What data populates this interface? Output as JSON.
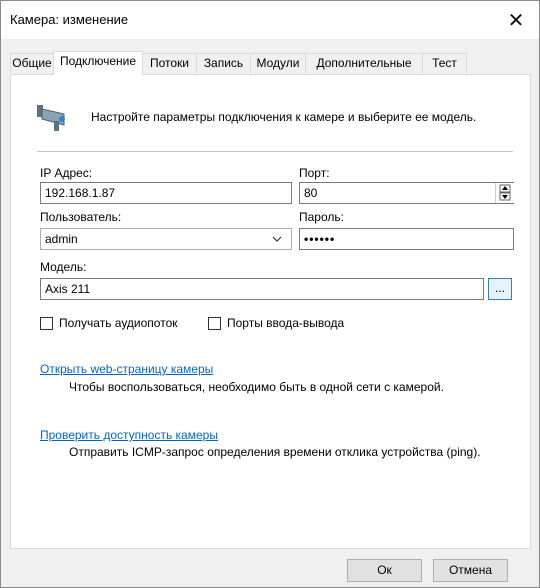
{
  "window": {
    "title": "Камера: изменение",
    "close_glyph": "✕"
  },
  "tabs": [
    {
      "label": "Общие",
      "active": false
    },
    {
      "label": "Подключение",
      "active": true
    },
    {
      "label": "Потоки",
      "active": false
    },
    {
      "label": "Запись",
      "active": false
    },
    {
      "label": "Модули",
      "active": false
    },
    {
      "label": "Дополнительные",
      "active": false
    },
    {
      "label": "Тест",
      "active": false
    }
  ],
  "intro": {
    "icon": "camera-icon",
    "text": "Настройте параметры подключения к камере и выберите ее модель."
  },
  "ip": {
    "label": "IP Адрес:",
    "value": "192.168.1.87"
  },
  "port": {
    "label": "Порт:",
    "value": "80"
  },
  "user": {
    "label": "Пользователь:",
    "value": "admin"
  },
  "password": {
    "label": "Пароль:",
    "value": "••••••"
  },
  "model": {
    "label": "Модель:",
    "value": "Axis 211",
    "browse_label": "..."
  },
  "checkboxes": {
    "audio": {
      "label": "Получать аудиопоток",
      "checked": false
    },
    "io_ports": {
      "label": "Порты ввода-вывода",
      "checked": false
    }
  },
  "links": {
    "open_web": {
      "label": "Открыть web-страницу камеры",
      "description": "Чтобы воспользоваться, необходимо быть в одной сети с камерой."
    },
    "ping": {
      "label": "Проверить доступность камеры",
      "description": "Отправить ICMP-запрос определения времени отклика устройства (ping)."
    }
  },
  "buttons": {
    "ok_label": "Ок",
    "cancel_label": "Отмена"
  },
  "colors": {
    "link": "#0066cc",
    "panel_bg": "#ffffff",
    "window_bg": "#f0f0f0"
  }
}
